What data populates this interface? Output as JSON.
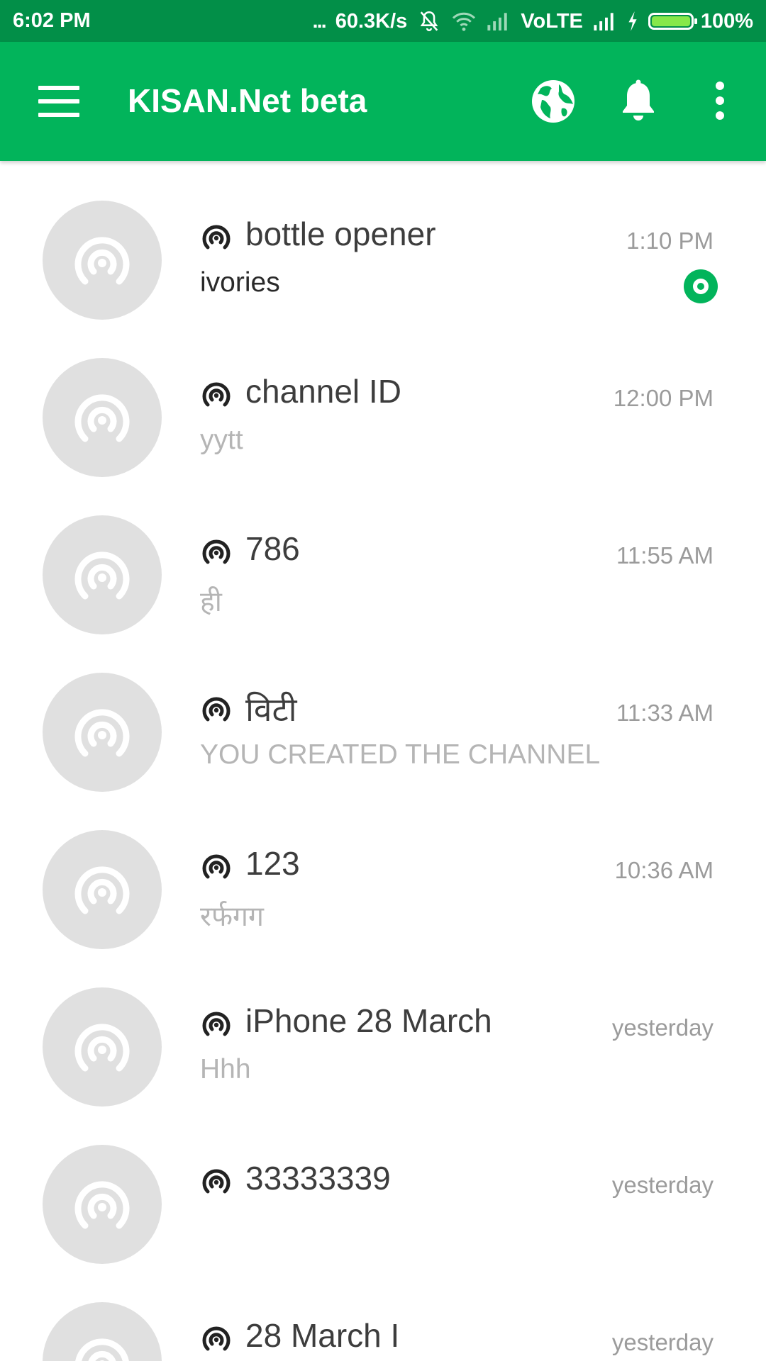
{
  "status_bar": {
    "time": "6:02 PM",
    "dots": "...",
    "speed": "60.3K/s",
    "network_label": "VoLTE",
    "battery": "100%",
    "battery_level": 1.0
  },
  "app_bar": {
    "title": "KISAN.Net beta",
    "color": "#02b45b",
    "status_color": "#028f48"
  },
  "channels": [
    {
      "name": "bottle opener",
      "time": "1:10 PM",
      "message": "ivories"
    },
    {
      "name": "channel ID",
      "time": "12:00 PM",
      "message": "yytt"
    },
    {
      "name": "786",
      "time": "11:55 AM",
      "message": "ही"
    },
    {
      "name": "विटी",
      "time": "11:33 AM",
      "message": "YOU CREATED THE CHANNEL"
    },
    {
      "name": "123",
      "time": "10:36 AM",
      "message": "रर्फगग"
    },
    {
      "name": "iPhone 28 March",
      "time": "yesterday",
      "message": "Hhh"
    },
    {
      "name": "33333339",
      "time": "yesterday",
      "message": ""
    },
    {
      "name": "28 March I",
      "time": "yesterday",
      "message": ""
    }
  ]
}
